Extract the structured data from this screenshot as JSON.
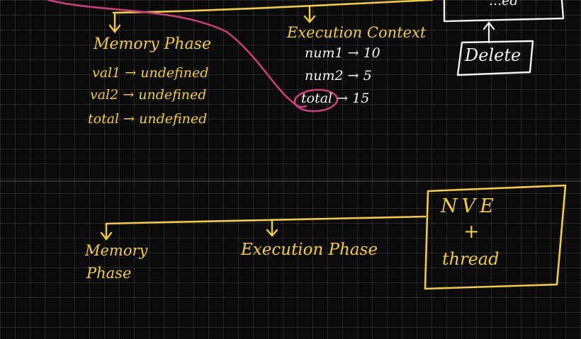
{
  "colors": {
    "background": "#0b0b0b",
    "grid": "#3a3a3a",
    "yellow_ink": "#f1cd3a",
    "pink_ink": "#c93f78",
    "white_ink": "#f2f2f2"
  },
  "top_section": {
    "memory_phase": {
      "title": "Memory Phase",
      "rows": [
        "val1 → undefined",
        "val2 → undefined",
        "total → undefined"
      ]
    },
    "execution_context": {
      "title": "Execution Context",
      "rows": [
        "num1 → 10",
        "num2 → 5",
        "total → 15"
      ]
    },
    "delete_box": {
      "label": "Delete"
    },
    "clipped_box": {
      "label": "...ed"
    }
  },
  "bottom_section": {
    "memory_phase": {
      "line1": "Memory",
      "line2": "Phase"
    },
    "execution_phase": {
      "label": "Execution Phase"
    },
    "box": {
      "line1": "NVE",
      "line2": "+",
      "line3": "thread"
    }
  }
}
